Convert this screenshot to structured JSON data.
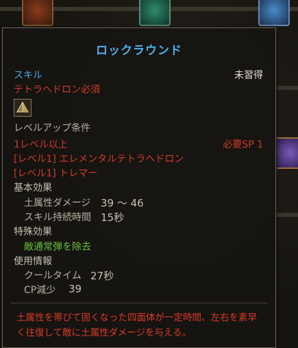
{
  "tooltip": {
    "title": "ロックラウンド",
    "category": "スキル",
    "status": "未習得",
    "requirement": "テトラヘドロン必須",
    "icon": "tetrahedron-rock-icon",
    "levelup_header": "レベルアップ条件",
    "levelup_level": "1レベル以上",
    "required_sp": "必要SP 1",
    "prereq_1": "[レベル1] エレメンタルテトラヘドロン",
    "prereq_2": "[レベル1] トレマー",
    "basic_header": "基本効果",
    "basic_effects": [
      {
        "label": "土属性ダメージ",
        "value": "39 ～ 46"
      },
      {
        "label": "スキル持続時間",
        "value": "15秒"
      }
    ],
    "special_header": "特殊効果",
    "special_effect": "敵通常弾を除去",
    "usage_header": "使用情報",
    "usage": [
      {
        "label": "クールタイム",
        "value": "27秒"
      },
      {
        "label": "CP減少",
        "value": "39"
      }
    ],
    "description": "土属性を帯びて固くなった四面体が一定時間、左右を素早く往復して敵に土属性ダメージを与える。"
  },
  "colors": {
    "title": "#4fb0f0",
    "warning": "#d03a2a",
    "special": "#6ac040"
  }
}
